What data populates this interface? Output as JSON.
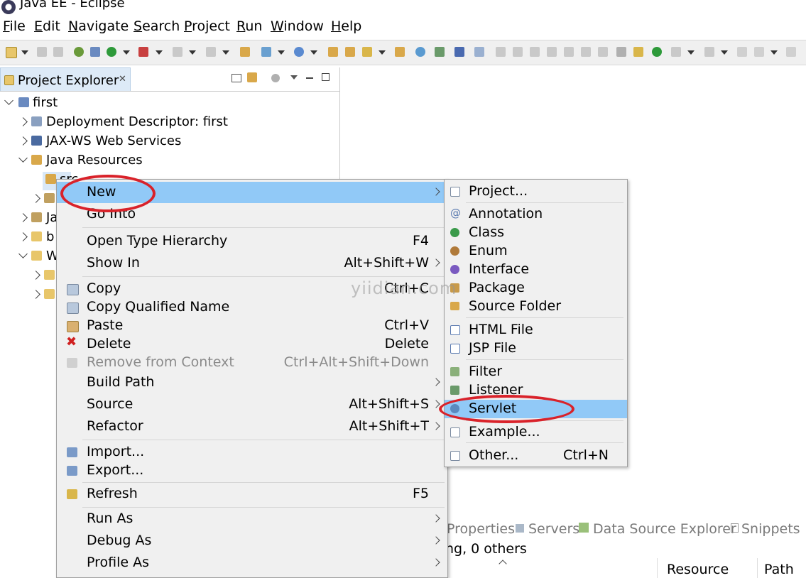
{
  "window": {
    "title": "Java EE - Eclipse"
  },
  "menubar": [
    "File",
    "Edit",
    "Navigate",
    "Search",
    "Project",
    "Run",
    "Window",
    "Help"
  ],
  "explorer": {
    "tab_label": "Project Explorer",
    "tree": [
      {
        "label": "first",
        "icon": "project-icon"
      },
      {
        "label": "Deployment Descriptor: first",
        "icon": "descriptor-icon"
      },
      {
        "label": "JAX-WS Web Services",
        "icon": "webservice-icon"
      },
      {
        "label": "Java Resources",
        "icon": "java-resources-icon"
      },
      {
        "label": "src",
        "icon": "package-folder-icon"
      },
      {
        "label": "Ja",
        "icon": "library-icon"
      },
      {
        "label": "b",
        "icon": "folder-icon"
      },
      {
        "label": "W",
        "icon": "folder-icon"
      }
    ]
  },
  "context_menu": {
    "items": [
      {
        "label": "New",
        "shortcut": "",
        "submenu": true
      },
      {
        "label": "Go Into",
        "shortcut": ""
      },
      {
        "label": "Open Type Hierarchy",
        "shortcut": "F4"
      },
      {
        "label": "Show In",
        "shortcut": "Alt+Shift+W",
        "submenu": true
      },
      {
        "label": "Copy",
        "shortcut": "Ctrl+C",
        "icon": "copy-icon"
      },
      {
        "label": "Copy Qualified Name",
        "shortcut": "",
        "icon": "copy-qualified-icon"
      },
      {
        "label": "Paste",
        "shortcut": "Ctrl+V",
        "icon": "paste-icon"
      },
      {
        "label": "Delete",
        "shortcut": "Delete",
        "icon": "delete-icon"
      },
      {
        "label": "Remove from Context",
        "shortcut": "Ctrl+Alt+Shift+Down",
        "disabled": true,
        "icon": "remove-context-icon"
      },
      {
        "label": "Build Path",
        "shortcut": "",
        "submenu": true
      },
      {
        "label": "Source",
        "shortcut": "Alt+Shift+S",
        "submenu": true
      },
      {
        "label": "Refactor",
        "shortcut": "Alt+Shift+T",
        "submenu": true
      },
      {
        "label": "Import...",
        "shortcut": "",
        "icon": "import-icon"
      },
      {
        "label": "Export...",
        "shortcut": "",
        "icon": "export-icon"
      },
      {
        "label": "Refresh",
        "shortcut": "F5",
        "icon": "refresh-icon"
      },
      {
        "label": "Run As",
        "shortcut": "",
        "submenu": true
      },
      {
        "label": "Debug As",
        "shortcut": "",
        "submenu": true
      },
      {
        "label": "Profile As",
        "shortcut": "",
        "submenu": true
      }
    ]
  },
  "new_submenu": {
    "items": [
      {
        "label": "Project...",
        "icon": "new-project-icon"
      },
      {
        "label": "Annotation",
        "icon": "annotation-icon"
      },
      {
        "label": "Class",
        "icon": "class-icon"
      },
      {
        "label": "Enum",
        "icon": "enum-icon"
      },
      {
        "label": "Interface",
        "icon": "interface-icon"
      },
      {
        "label": "Package",
        "icon": "package-icon"
      },
      {
        "label": "Source Folder",
        "icon": "source-folder-icon"
      },
      {
        "label": "HTML File",
        "icon": "html-file-icon"
      },
      {
        "label": "JSP File",
        "icon": "jsp-file-icon"
      },
      {
        "label": "Filter",
        "icon": "filter-icon"
      },
      {
        "label": "Listener",
        "icon": "listener-icon"
      },
      {
        "label": "Servlet",
        "icon": "servlet-icon"
      },
      {
        "label": "Example...",
        "icon": "example-icon"
      },
      {
        "label": "Other...",
        "shortcut": "Ctrl+N",
        "icon": "other-icon"
      }
    ]
  },
  "bottom_panel": {
    "tabs": [
      "Properties",
      "Servers",
      "Data Source Explorer",
      "Snippets"
    ],
    "status": "ng, 0 others",
    "columns": [
      "Resource",
      "Path"
    ]
  },
  "watermark": "yiidian.com",
  "colors": {
    "highlight": "#91c9f7",
    "annotation_ring": "#d9222a",
    "menu_bg": "#f0f0f0"
  }
}
